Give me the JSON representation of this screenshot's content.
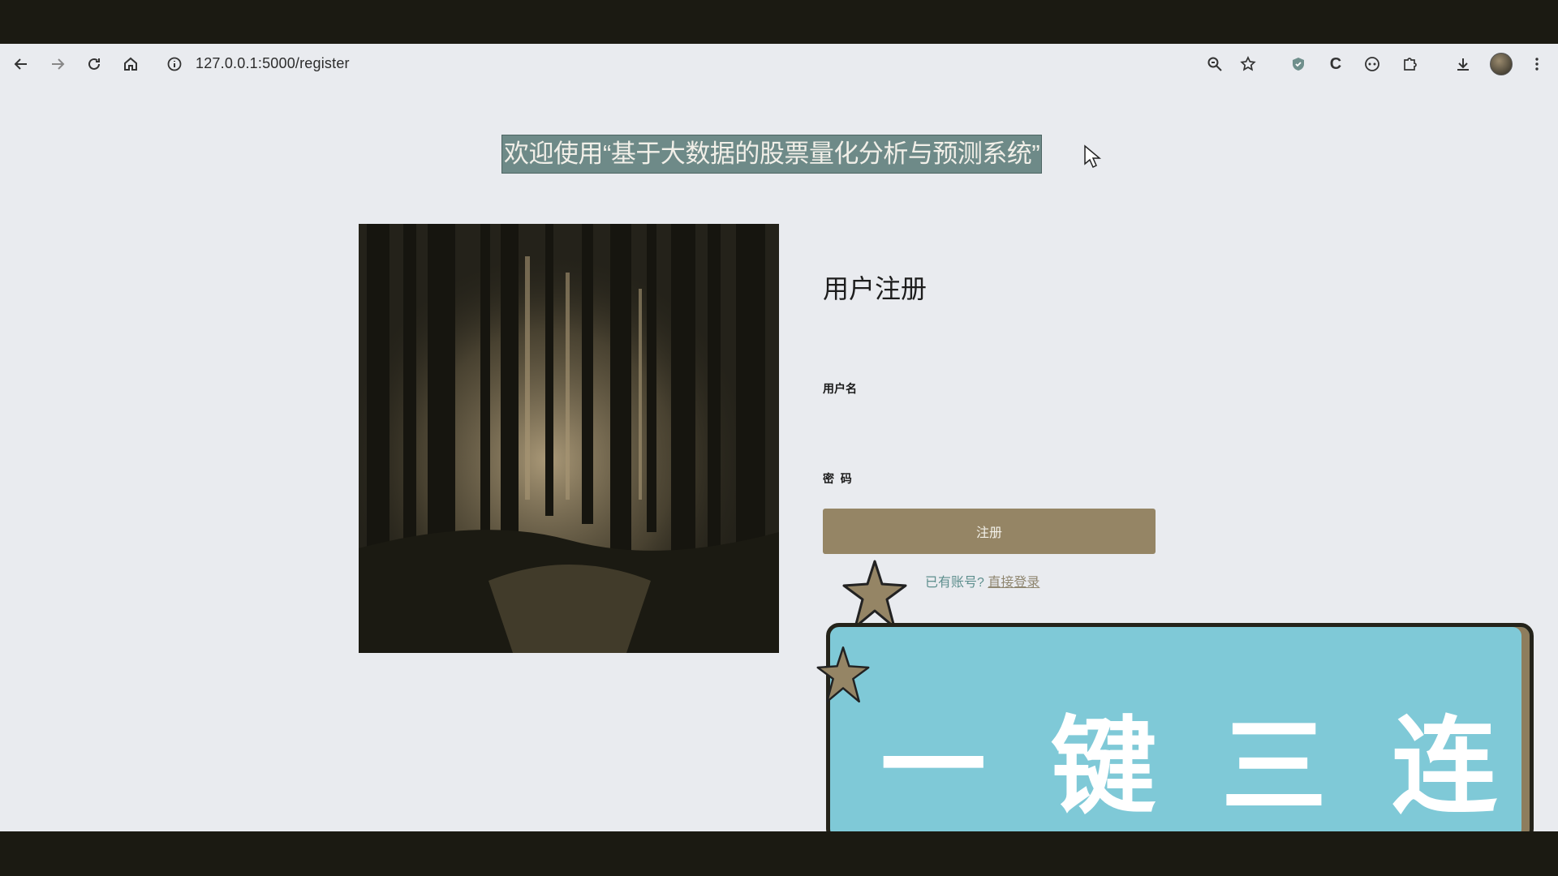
{
  "browser": {
    "url": "127.0.0.1:5000/register",
    "nav_icons": [
      "back-icon",
      "forward-icon",
      "reload-icon",
      "home-icon",
      "site-info-icon"
    ],
    "action_icons": [
      "zoom-icon",
      "bookmark-star-icon",
      "shield-extension-icon",
      "c-extension-icon",
      "face-extension-icon",
      "extensions-puzzle-icon",
      "download-icon",
      "profile-avatar",
      "more-menu-icon"
    ]
  },
  "page": {
    "headline": "欢迎使用“基于大数据的股票量化分析与预测系统”",
    "headline_bg": "#6e8a88"
  },
  "register_form": {
    "title": "用户注册",
    "username_label": "用户名",
    "username_value": "",
    "password_label": "密  码",
    "password_value": "",
    "submit_label": "注册",
    "has_account_text": "已有账号?",
    "login_link": "直接登录"
  },
  "overlay": {
    "banner_text": [
      "一",
      "键",
      "三",
      "连"
    ],
    "banner_color": "#7fc9d7",
    "accent_color": "#958565"
  }
}
